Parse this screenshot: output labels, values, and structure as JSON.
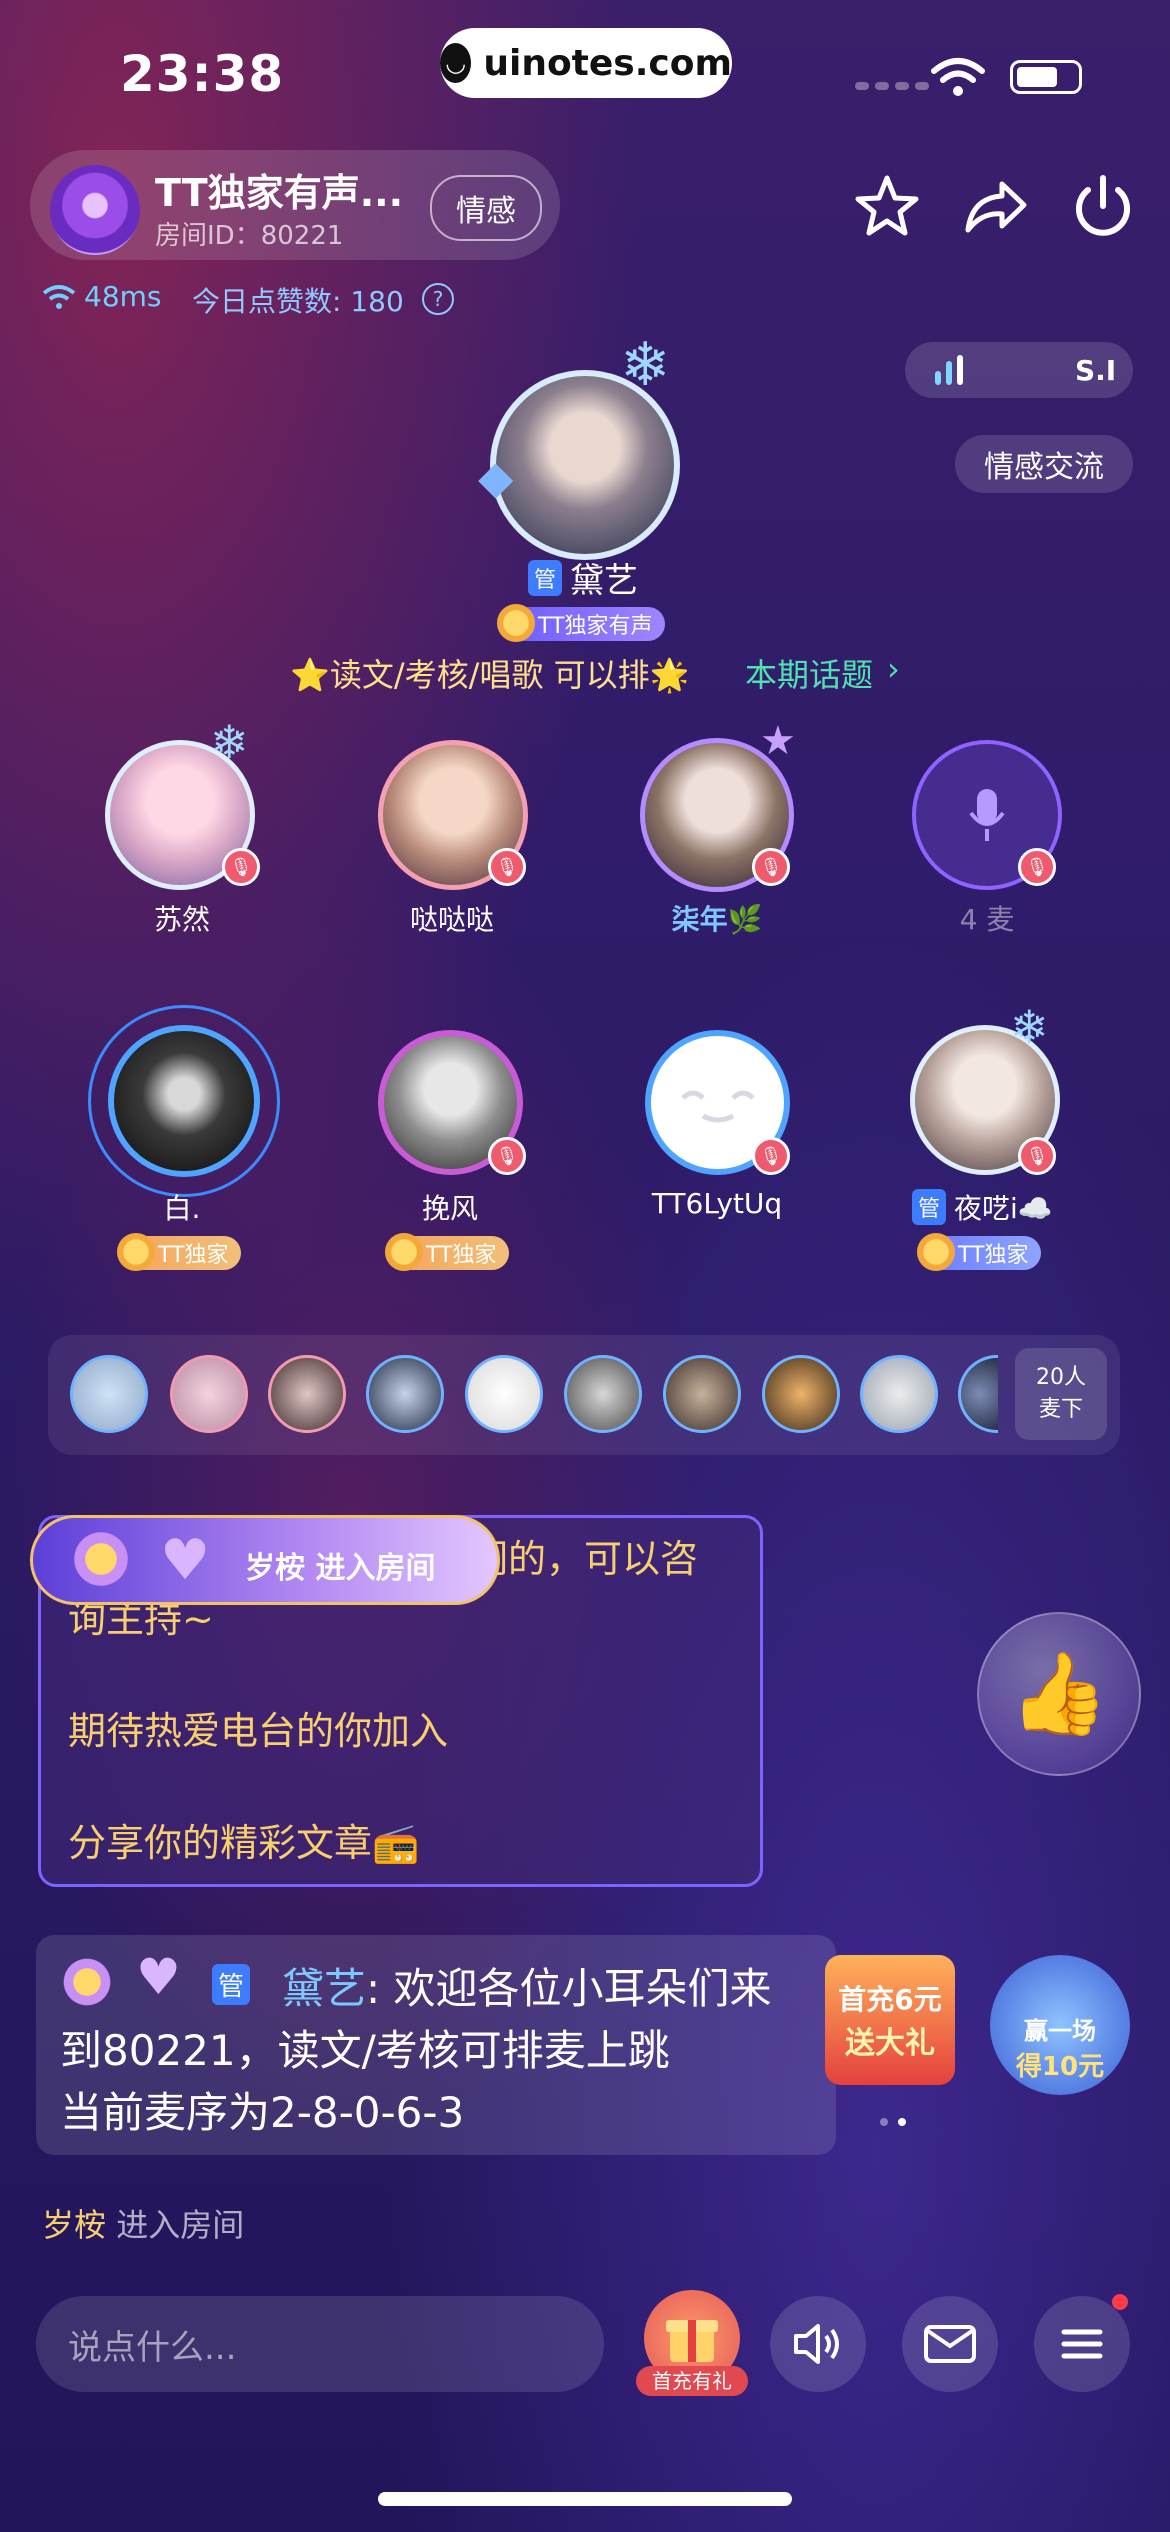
{
  "status_bar": {
    "time": "23:38",
    "url": "uinotes.com"
  },
  "room": {
    "title": "TT独家有声...",
    "id_label": "房间ID：80221",
    "tag": "情感",
    "ping": "48ms",
    "likes_label": "今日点赞数: 180",
    "music_text": "S.I",
    "topic_tag": "情感交流",
    "topic_line": "⭐读文/考核/唱歌 可以排🌟",
    "topic_link": "本期话题"
  },
  "host": {
    "admin_tag": "管",
    "name": "黛艺",
    "badge": "TT独家有声"
  },
  "seats_row1": [
    {
      "name": "苏然",
      "color": "#ffffff"
    },
    {
      "name": "哒哒哒",
      "color": "#ffffff"
    },
    {
      "name": "柒年🌿",
      "color": "#7fc8ff"
    },
    {
      "name": "4 麦",
      "color": "rgba(255,255,255,0.45)"
    }
  ],
  "seats_row2": [
    {
      "name": "白.",
      "badge": "TT独家"
    },
    {
      "name": "挽风",
      "badge": "TT独家"
    },
    {
      "name": "TT6LytUq",
      "badge": ""
    },
    {
      "name": "夜呓i☁️",
      "badge": "TT独家",
      "admin": "管"
    }
  ],
  "audience": {
    "mic_count_line1": "20人",
    "mic_count_line2": "麦下"
  },
  "notice": {
    "line1": "们的，可以咨",
    "line2": "询主持~",
    "line3": "期待热爱电台的你加入",
    "line4": "分享你的精彩文章📻"
  },
  "enter_banner": {
    "user": "岁桉",
    "action": "进入房间"
  },
  "message": {
    "admin_tag": "管",
    "user": "黛艺",
    "line1": ": 欢迎各位小耳朵们来",
    "line2": "到80221，读文/考核可排麦上跳",
    "line3": "当前麦序为2-8-0-6-3"
  },
  "promo1": {
    "line1": "首充6元",
    "line2": "送大礼"
  },
  "promo2": {
    "line1": "赢一场",
    "line2": "得10元"
  },
  "enter_log": {
    "user": "岁桉",
    "action": "进入房间"
  },
  "bottom": {
    "placeholder": "说点什么...",
    "gift_label": "首充有礼"
  },
  "colors": {
    "accent": "#4fe2b0",
    "chat_gold": "#f8cf6d",
    "mute_red": "#f05a6e"
  }
}
